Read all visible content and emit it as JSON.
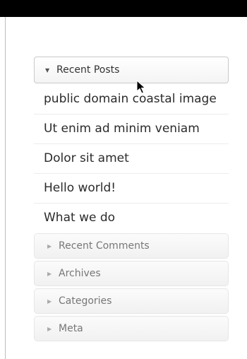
{
  "widget": {
    "open_section": {
      "title": "Recent Posts",
      "icon": "triangle-down-icon"
    },
    "posts": [
      "public domain coastal image",
      "Ut enim ad minim veniam",
      "Dolor sit amet",
      "Hello world!",
      "What we do"
    ],
    "collapsed_sections": [
      "Recent Comments",
      "Archives",
      "Categories",
      "Meta"
    ],
    "collapsed_icon": "triangle-right-icon"
  }
}
